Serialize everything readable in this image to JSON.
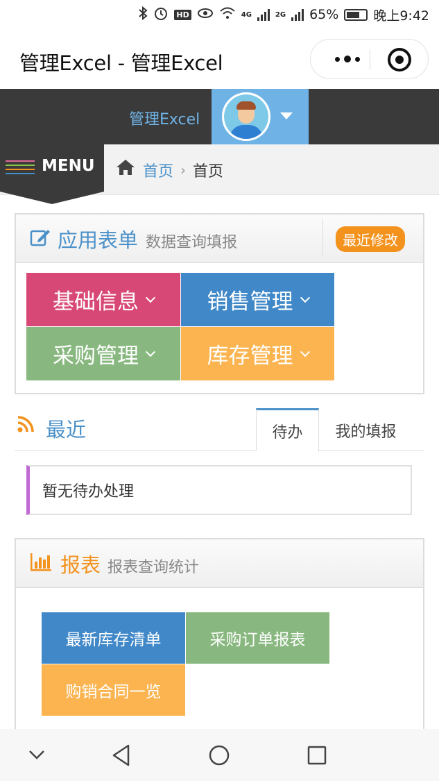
{
  "status_bar": {
    "network1": "4G",
    "network2": "2G",
    "battery": "65%",
    "time": "晚上9:42",
    "icons": [
      "bluetooth-icon",
      "alarm-icon",
      "hd-icon",
      "eye-icon",
      "wifi-icon",
      "signal-icon",
      "battery-icon"
    ]
  },
  "titlebar": {
    "title": "管理Excel - 管理Excel"
  },
  "header": {
    "brand": "管理Excel"
  },
  "menubar": {
    "menu_label": "MENU",
    "breadcrumb": {
      "home": "首页",
      "current": "首页"
    }
  },
  "app_forms": {
    "title": "应用表单",
    "subtitle": "数据查询填报",
    "badge": "最近修改",
    "tiles": [
      {
        "label": "基础信息",
        "color": "#d84877"
      },
      {
        "label": "销售管理",
        "color": "#4088c8"
      },
      {
        "label": "采购管理",
        "color": "#88b87f"
      },
      {
        "label": "库存管理",
        "color": "#fbb450"
      }
    ]
  },
  "recent": {
    "title": "最近",
    "tabs": [
      "待办",
      "我的填报"
    ],
    "empty_text": "暂无待办处理"
  },
  "reports": {
    "title": "报表",
    "subtitle": "报表查询统计",
    "tiles": [
      {
        "label": "最新库存清单",
        "color": "#4088c8"
      },
      {
        "label": "采购订单报表",
        "color": "#88b87f"
      },
      {
        "label": "购销合同一览",
        "color": "#fbb450"
      }
    ]
  },
  "colors": {
    "accent_blue": "#4a90c8",
    "accent_orange": "#f3921d",
    "header_dark": "#3a3a3a"
  }
}
